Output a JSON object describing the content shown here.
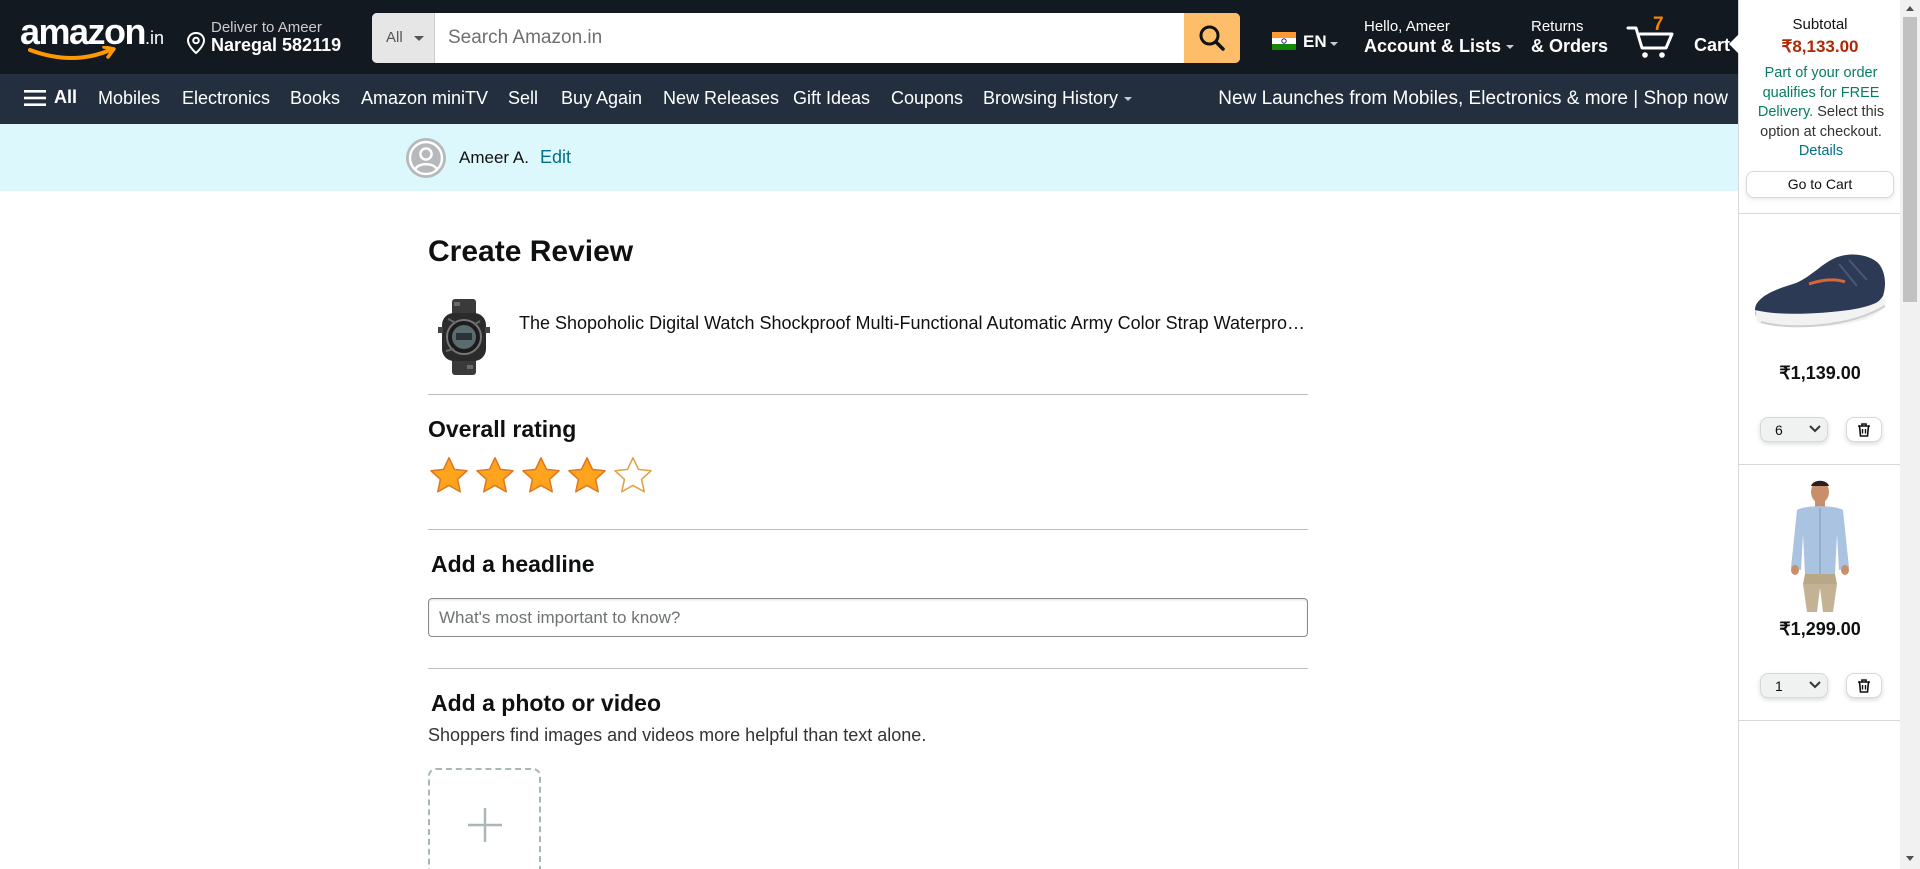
{
  "header": {
    "logo": "amazon",
    "logo_suffix": ".in",
    "deliver_line1": "Deliver to Ameer",
    "deliver_line2": "Naregal 582119",
    "search_category": "All",
    "search_placeholder": "Search Amazon.in",
    "language": "EN",
    "account_line1": "Hello, Ameer",
    "account_line2": "Account & Lists",
    "returns_line1": "Returns",
    "returns_line2": "& Orders",
    "cart_count": "7",
    "cart_label": "Cart"
  },
  "subnav": {
    "all_label": "All",
    "items": [
      "Mobiles",
      "Electronics",
      "Books",
      "Amazon miniTV",
      "Sell",
      "Buy Again",
      "New Releases",
      "Gift Ideas",
      "Coupons",
      "Browsing History"
    ],
    "promo": "New Launches from Mobiles, Electronics & more | Shop now"
  },
  "profile": {
    "name": "Ameer A.",
    "edit_label": "Edit"
  },
  "review": {
    "title": "Create Review",
    "product_title": "The Shopoholic Digital Watch Shockproof Multi-Functional Automatic Army Color Strap Waterproof Digital Sports Watch for Men",
    "overall_rating_label": "Overall rating",
    "rating": 4,
    "rating_max": 5,
    "headline_label": "Add a headline",
    "headline_placeholder": "What's most important to know?",
    "photo_label": "Add a photo or video",
    "photo_subtext": "Shoppers find images and videos more helpful than text alone."
  },
  "cart_panel": {
    "subtotal_label": "Subtotal",
    "subtotal_value": "₹8,133.00",
    "free_part1": "Part of your order qualifies for FREE Delivery.",
    "free_part2": " Select this option at checkout.",
    "details_link": "Details",
    "go_to_cart": "Go to Cart",
    "items": [
      {
        "price": "₹1,139.00",
        "qty": "6",
        "image": "sneaker"
      },
      {
        "price": "₹1,299.00",
        "qty": "1",
        "image": "shirt-model"
      }
    ]
  },
  "colors": {
    "nav_bg": "#131921",
    "subnav_bg": "#232f3e",
    "search_button": "#febd69",
    "star_fill": "#ffa41c",
    "price_red": "#b12704",
    "link_teal": "#007185",
    "profile_bar": "#ddf8fd"
  }
}
